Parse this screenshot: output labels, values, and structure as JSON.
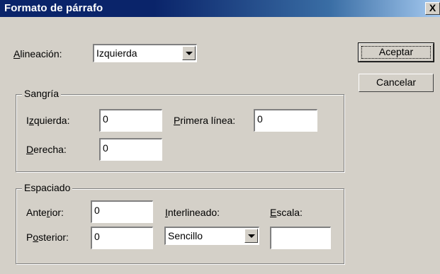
{
  "window": {
    "title": "Formato de párrafo",
    "close_glyph": "X"
  },
  "alineacion": {
    "label_ul": "A",
    "label_rest": "lineación:",
    "value": "Izquierda"
  },
  "buttons": {
    "ok": "Aceptar",
    "cancel": "Cancelar"
  },
  "sangria": {
    "legend": "Sangría",
    "izquierda": {
      "pre": "I",
      "ul": "z",
      "post": "quierda:",
      "value": "0"
    },
    "derecha": {
      "pre": "",
      "ul": "D",
      "post": "erecha:",
      "value": "0"
    },
    "primera": {
      "pre": "",
      "ul": "P",
      "post": "rimera línea:",
      "value": "0"
    }
  },
  "espaciado": {
    "legend": "Espaciado",
    "anterior": {
      "pre": "Ante",
      "ul": "r",
      "post": "ior:",
      "value": "0"
    },
    "posterior": {
      "pre": "P",
      "ul": "o",
      "post": "sterior:",
      "value": "0"
    },
    "interlineado": {
      "pre": "",
      "ul": "I",
      "post": "nterlineado:",
      "value": "Sencillo"
    },
    "escala": {
      "pre": "",
      "ul": "E",
      "post": "scala:",
      "value": ""
    }
  }
}
